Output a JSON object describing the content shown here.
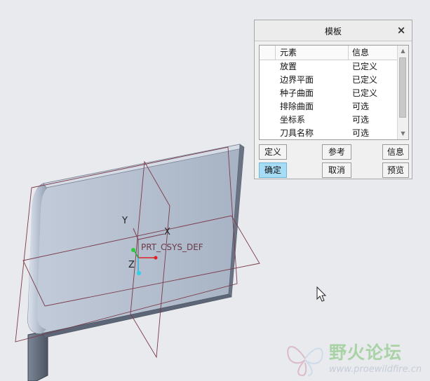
{
  "scene": {
    "csys_name": "PRT_CSYS_DEF",
    "axis_labels": {
      "x": "X",
      "y": "Y",
      "z": "Z"
    },
    "cursor": "arrow-pointer"
  },
  "dialog": {
    "title": "模板",
    "close_icon": "×",
    "table": {
      "headers": {
        "element": "元素",
        "info": "信息"
      },
      "rows": [
        {
          "element": "放置",
          "info": "已定义"
        },
        {
          "element": "边界平面",
          "info": "已定义"
        },
        {
          "element": "种子曲面",
          "info": "已定义"
        },
        {
          "element": "排除曲面",
          "info": "可选"
        },
        {
          "element": "坐标系",
          "info": "可选"
        },
        {
          "element": "刀具名称",
          "info": "可选"
        }
      ]
    },
    "buttons": {
      "define": "定义",
      "reference": "参考",
      "info": "信息",
      "ok": "确定",
      "cancel": "取消",
      "preview": "预览"
    }
  },
  "watermark": {
    "title": "野火论坛",
    "url": "www.proewildfire.cn"
  },
  "colors": {
    "background": "#e9eaed",
    "surface": "#a3aebf",
    "datum_plane": "#7a3a4a",
    "ok_button": "#a7dcf5"
  }
}
